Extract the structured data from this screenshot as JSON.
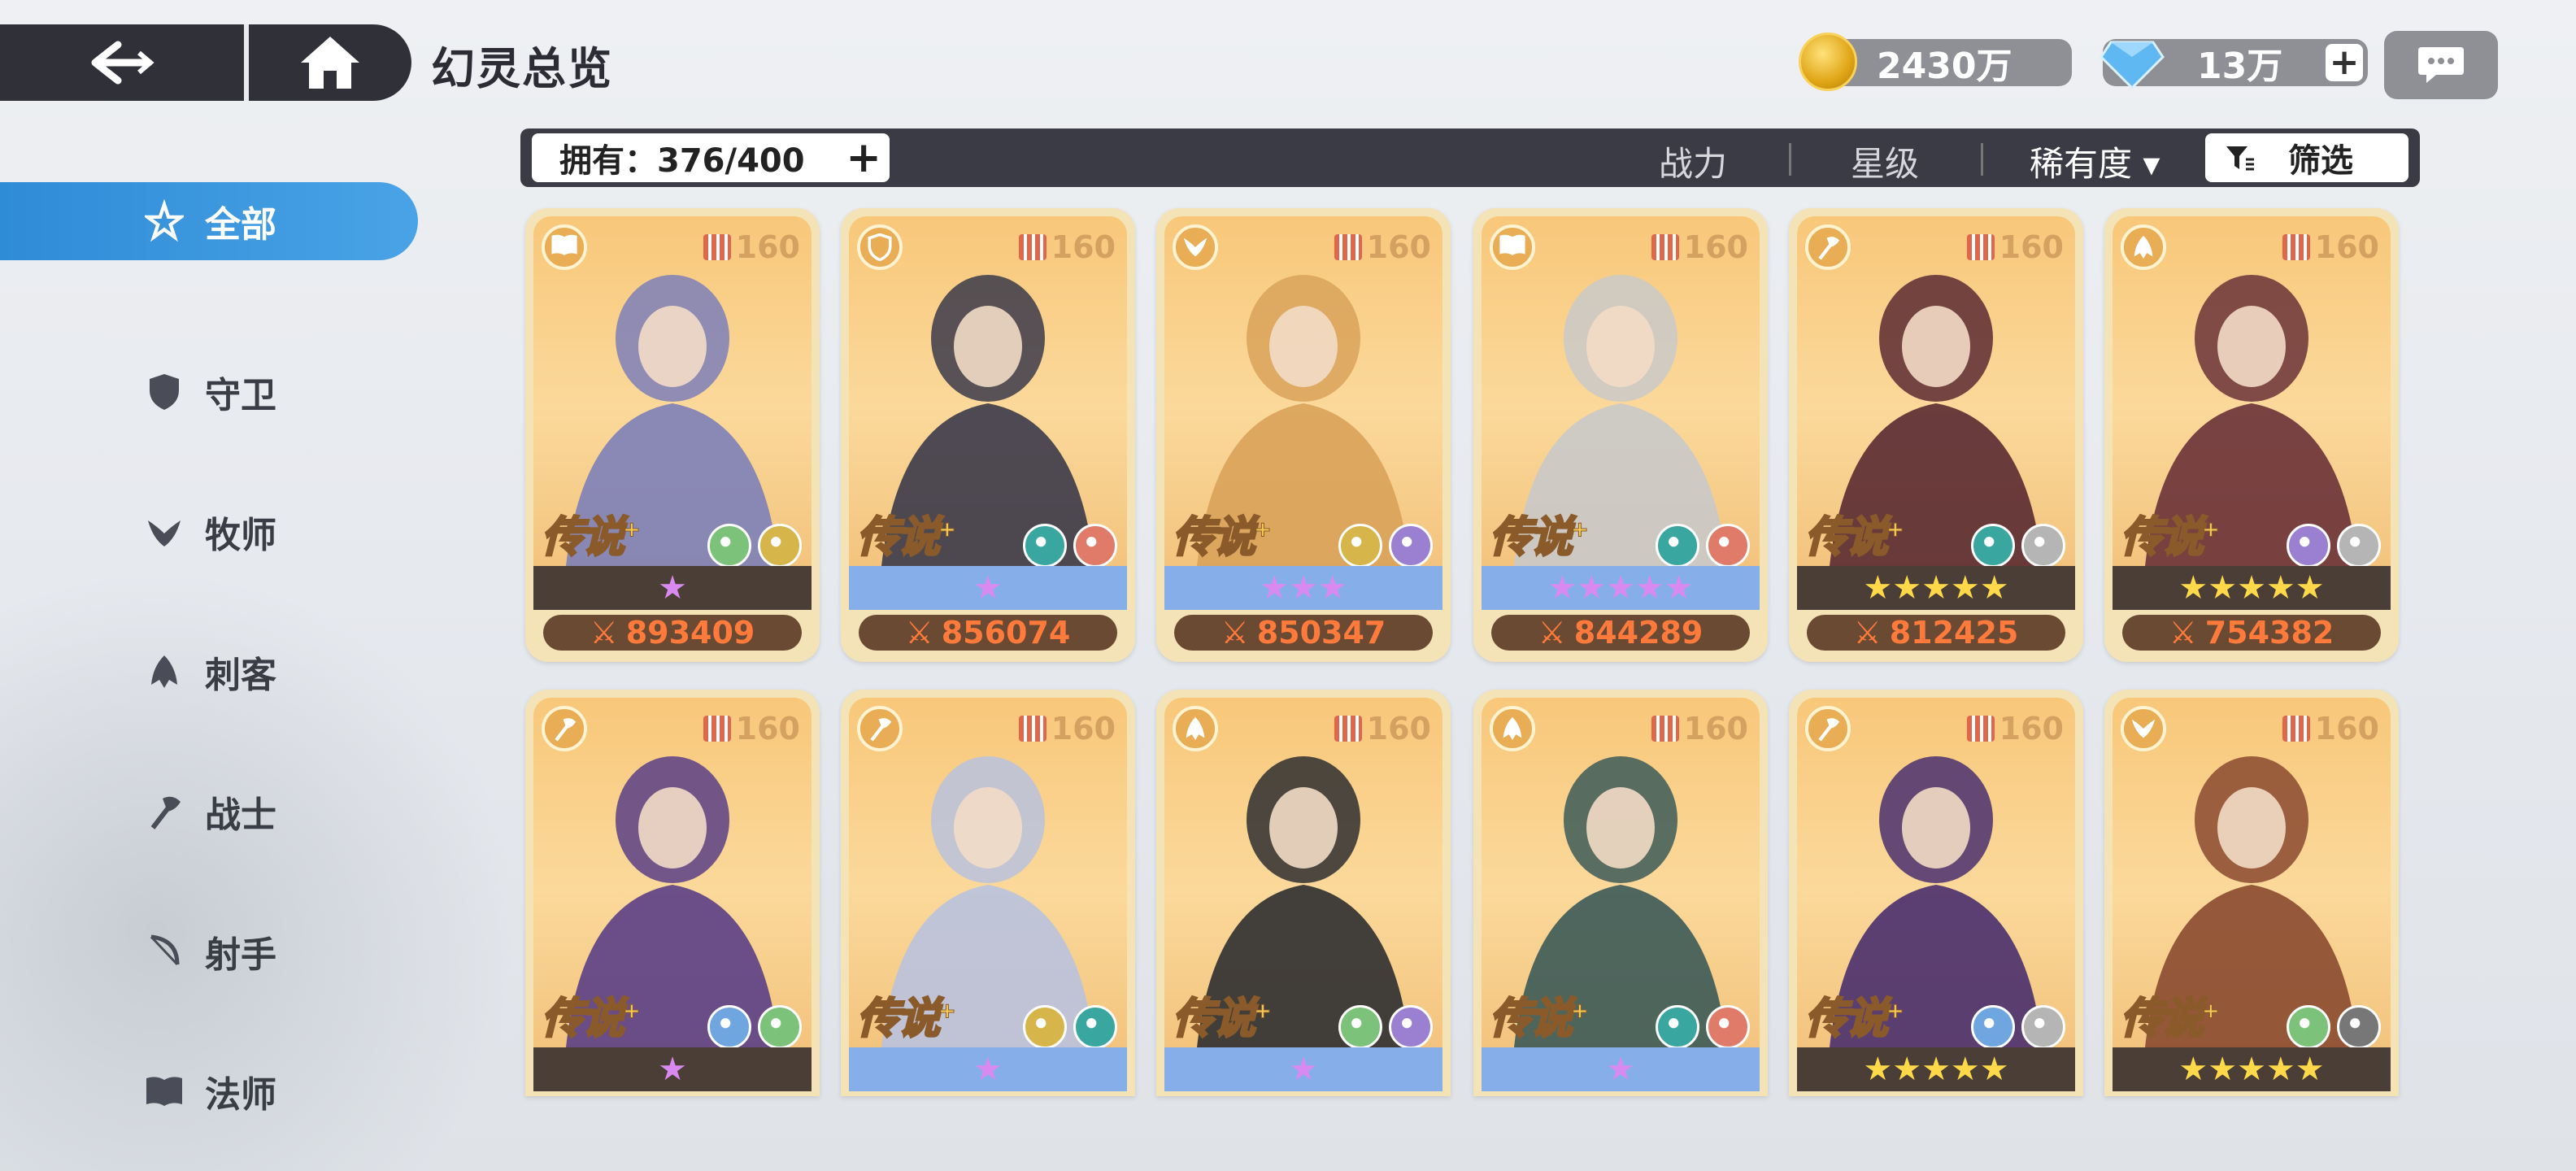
{
  "header": {
    "title": "幻灵总览",
    "gold": "2430万",
    "gems": "13万"
  },
  "sidebar": {
    "items": [
      {
        "label": "全部",
        "icon": "all-classes-icon",
        "active": true
      },
      {
        "label": "守卫",
        "icon": "shield-icon",
        "active": false
      },
      {
        "label": "牧师",
        "icon": "wings-icon",
        "active": false
      },
      {
        "label": "刺客",
        "icon": "assassin-icon",
        "active": false
      },
      {
        "label": "战士",
        "icon": "axe-icon",
        "active": false
      },
      {
        "label": "射手",
        "icon": "bow-icon",
        "active": false
      },
      {
        "label": "法师",
        "icon": "book-icon",
        "active": false
      }
    ]
  },
  "filter_bar": {
    "owned_label": "拥有：376/400",
    "sort_power": "战力",
    "sort_star": "星级",
    "sort_rarity": "稀有度 ▾",
    "filter_label": "筛选"
  },
  "cards": [
    {
      "rarity": "传说",
      "level": "160",
      "stars": "★",
      "power": "893409",
      "strip": "dark",
      "class_icon": "book-icon",
      "elements": [
        "#7cc27a",
        "#d6b64a"
      ],
      "portrait": "#7d7fb8"
    },
    {
      "rarity": "传说",
      "level": "160",
      "stars": "★",
      "power": "856074",
      "strip": "blue",
      "class_icon": "shield-icon",
      "elements": [
        "#3aa6a0",
        "#e07b6a"
      ],
      "portrait": "#3b3a4a"
    },
    {
      "rarity": "传说",
      "level": "160",
      "stars": "★★★",
      "power": "850347",
      "strip": "blue",
      "class_icon": "wings-icon",
      "elements": [
        "#d6b64a",
        "#9b7fd1"
      ],
      "portrait": "#d9a25a"
    },
    {
      "rarity": "传说",
      "level": "160",
      "stars": "★★★★★",
      "power": "844289",
      "strip": "blue",
      "class_icon": "book-icon",
      "elements": [
        "#3aa6a0",
        "#e07b6a"
      ],
      "portrait": "#c9c9c9"
    },
    {
      "rarity": "传说",
      "level": "160",
      "stars": "★★★★★",
      "power": "812425",
      "strip": "dark",
      "class_icon": "axe-icon",
      "elements": [
        "#3aa6a0",
        "#b5b5b5"
      ],
      "portrait": "#5a2a32"
    },
    {
      "rarity": "传说",
      "level": "160",
      "stars": "★★★★★",
      "power": "754382",
      "strip": "dark",
      "class_icon": "assassin-icon",
      "elements": [
        "#9b7fd1",
        "#b5b5b5"
      ],
      "portrait": "#6a3238"
    },
    {
      "rarity": "传说",
      "level": "160",
      "stars": "★",
      "power": "",
      "strip": "dark",
      "class_icon": "axe-icon",
      "elements": [
        "#6fa6e0",
        "#7cc27a"
      ],
      "portrait": "#5b3f86"
    },
    {
      "rarity": "传说",
      "level": "160",
      "stars": "★",
      "power": "",
      "strip": "blue",
      "class_icon": "axe-icon",
      "elements": [
        "#d6b64a",
        "#3aa6a0"
      ],
      "portrait": "#b9c2de"
    },
    {
      "rarity": "传说",
      "level": "160",
      "stars": "★",
      "power": "",
      "strip": "blue",
      "class_icon": "assassin-icon",
      "elements": [
        "#7cc27a",
        "#9b7fd1"
      ],
      "portrait": "#2e2e30"
    },
    {
      "rarity": "传说",
      "level": "160",
      "stars": "★",
      "power": "",
      "strip": "blue",
      "class_icon": "assassin-icon",
      "elements": [
        "#3aa6a0",
        "#e07b6a"
      ],
      "portrait": "#3c5a58"
    },
    {
      "rarity": "传说",
      "level": "160",
      "stars": "★★★★★",
      "power": "",
      "strip": "dark",
      "class_icon": "axe-icon",
      "elements": [
        "#6fa6e0",
        "#b5b5b5"
      ],
      "portrait": "#4a2f6e"
    },
    {
      "rarity": "传说",
      "level": "160",
      "stars": "★★★★★",
      "power": "",
      "strip": "dark",
      "class_icon": "wings-icon",
      "elements": [
        "#7cc27a",
        "#777777"
      ],
      "portrait": "#8a4a30"
    }
  ]
}
